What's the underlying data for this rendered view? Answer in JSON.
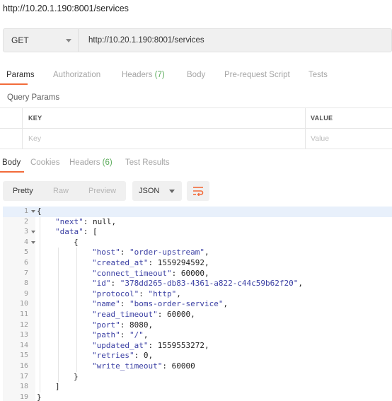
{
  "page": {
    "url_title": "http://10.20.1.190:8001/services"
  },
  "request": {
    "method": "GET",
    "url": "http://10.20.1.190:8001/services"
  },
  "request_tabs": {
    "params": "Params",
    "authorization": "Authorization",
    "headers": "Headers",
    "headers_count": "(7)",
    "body": "Body",
    "prerequest": "Pre-request Script",
    "tests": "Tests"
  },
  "query_params": {
    "label": "Query Params",
    "key_header": "KEY",
    "value_header": "VALUE",
    "key_placeholder": "Key",
    "value_placeholder": "Value"
  },
  "response_tabs": {
    "body": "Body",
    "cookies": "Cookies",
    "headers": "Headers",
    "headers_count": "(6)",
    "test_results": "Test Results"
  },
  "view_options": {
    "pretty": "Pretty",
    "raw": "Raw",
    "preview": "Preview",
    "format": "JSON"
  },
  "colors": {
    "accent": "#f26b3a",
    "count_green": "#5cac5c",
    "json_key": "#3a3fa3"
  },
  "response_lines": [
    {
      "n": "1",
      "fold": true,
      "indent": 0,
      "text": "{"
    },
    {
      "n": "2",
      "fold": false,
      "indent": 1,
      "key": "next",
      "value": "null",
      "comma": true
    },
    {
      "n": "3",
      "fold": true,
      "indent": 1,
      "key": "data",
      "value": "[",
      "comma": false
    },
    {
      "n": "4",
      "fold": true,
      "indent": 2,
      "text": "{"
    },
    {
      "n": "5",
      "fold": false,
      "indent": 3,
      "key": "host",
      "value": "\"order-upstream\"",
      "comma": true
    },
    {
      "n": "6",
      "fold": false,
      "indent": 3,
      "key": "created_at",
      "value": "1559294592",
      "comma": true
    },
    {
      "n": "7",
      "fold": false,
      "indent": 3,
      "key": "connect_timeout",
      "value": "60000",
      "comma": true
    },
    {
      "n": "8",
      "fold": false,
      "indent": 3,
      "key": "id",
      "value": "\"378dd265-db83-4361-a822-c44c59b62f20\"",
      "comma": true
    },
    {
      "n": "9",
      "fold": false,
      "indent": 3,
      "key": "protocol",
      "value": "\"http\"",
      "comma": true
    },
    {
      "n": "10",
      "fold": false,
      "indent": 3,
      "key": "name",
      "value": "\"boms-order-service\"",
      "comma": true
    },
    {
      "n": "11",
      "fold": false,
      "indent": 3,
      "key": "read_timeout",
      "value": "60000",
      "comma": true
    },
    {
      "n": "12",
      "fold": false,
      "indent": 3,
      "key": "port",
      "value": "8080",
      "comma": true
    },
    {
      "n": "13",
      "fold": false,
      "indent": 3,
      "key": "path",
      "value": "\"/\"",
      "comma": true
    },
    {
      "n": "14",
      "fold": false,
      "indent": 3,
      "key": "updated_at",
      "value": "1559553272",
      "comma": true
    },
    {
      "n": "15",
      "fold": false,
      "indent": 3,
      "key": "retries",
      "value": "0",
      "comma": true
    },
    {
      "n": "16",
      "fold": false,
      "indent": 3,
      "key": "write_timeout",
      "value": "60000",
      "comma": false
    },
    {
      "n": "17",
      "fold": false,
      "indent": 2,
      "text": "}"
    },
    {
      "n": "18",
      "fold": false,
      "indent": 1,
      "text": "]"
    },
    {
      "n": "19",
      "fold": false,
      "indent": 0,
      "text": "}"
    }
  ]
}
